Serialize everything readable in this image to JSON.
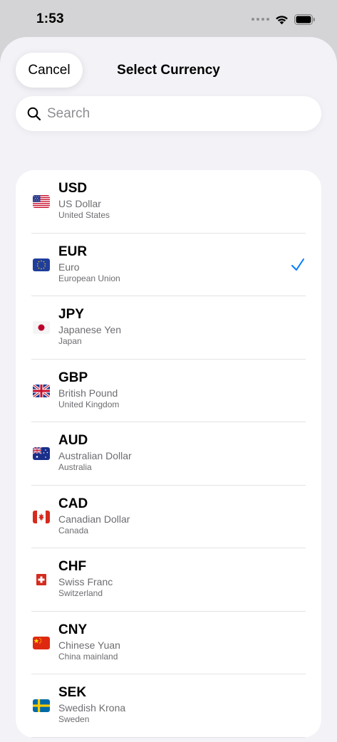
{
  "status_bar": {
    "time": "1:53"
  },
  "header": {
    "cancel_label": "Cancel",
    "title": "Select Currency"
  },
  "search": {
    "placeholder": "Search",
    "value": ""
  },
  "selected_code": "EUR",
  "currencies": [
    {
      "code": "USD",
      "name": "US Dollar",
      "country": "United States",
      "flag": "us-flag"
    },
    {
      "code": "EUR",
      "name": "Euro",
      "country": "European Union",
      "flag": "eu-flag"
    },
    {
      "code": "JPY",
      "name": "Japanese Yen",
      "country": "Japan",
      "flag": "jp-flag"
    },
    {
      "code": "GBP",
      "name": "British Pound",
      "country": "United Kingdom",
      "flag": "gb-flag"
    },
    {
      "code": "AUD",
      "name": "Australian Dollar",
      "country": "Australia",
      "flag": "au-flag"
    },
    {
      "code": "CAD",
      "name": "Canadian Dollar",
      "country": "Canada",
      "flag": "ca-flag"
    },
    {
      "code": "CHF",
      "name": "Swiss Franc",
      "country": "Switzerland",
      "flag": "ch-flag"
    },
    {
      "code": "CNY",
      "name": "Chinese Yuan",
      "country": "China mainland",
      "flag": "cn-flag"
    },
    {
      "code": "SEK",
      "name": "Swedish Krona",
      "country": "Sweden",
      "flag": "se-flag"
    }
  ],
  "colors": {
    "accent": "#007aff",
    "background": "#f2f2f7"
  }
}
